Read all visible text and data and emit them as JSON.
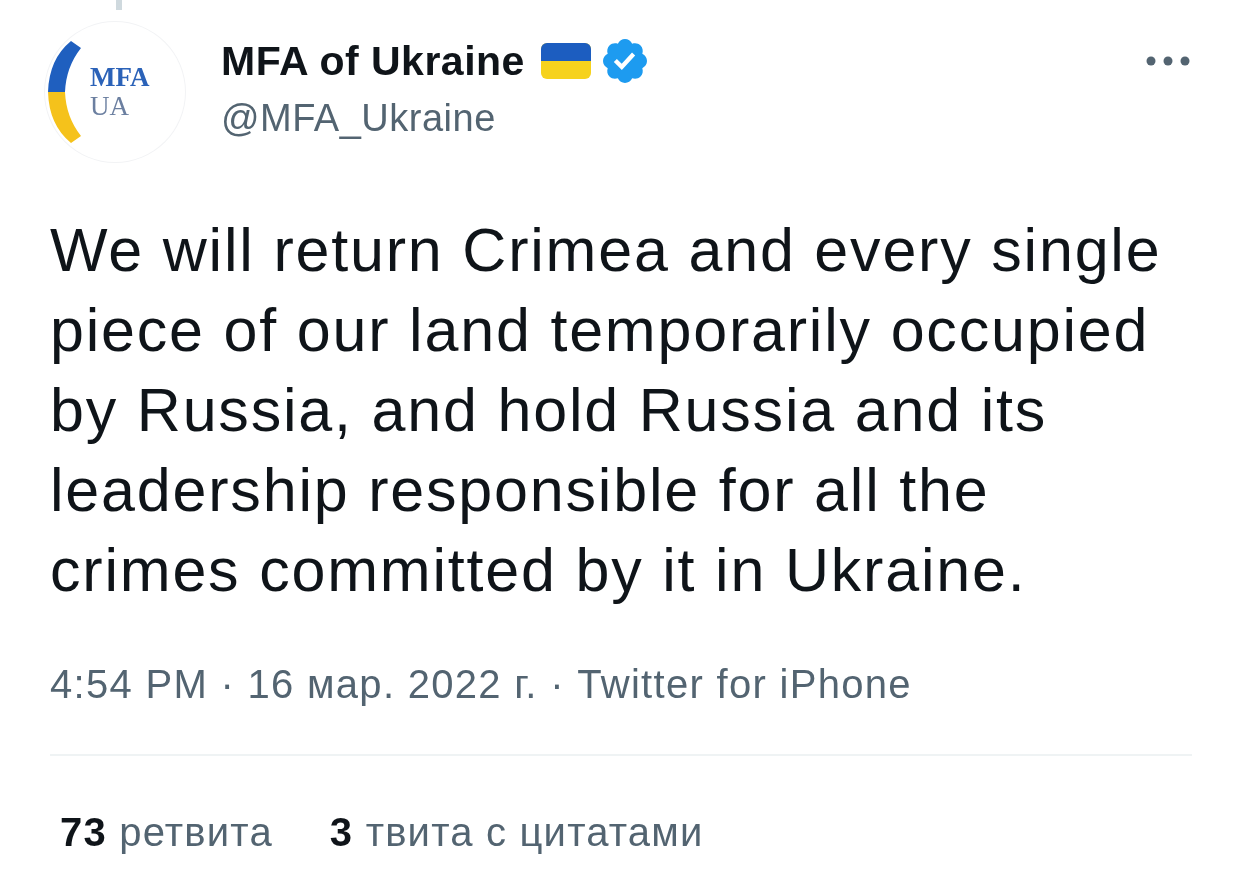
{
  "author": {
    "avatar_logo": [
      "MFA",
      "UA"
    ],
    "name": "MFA of Ukraine",
    "verified": true,
    "handle": "@MFA_Ukraine"
  },
  "tweet": {
    "text": "We will return Crimea and every single piece of our land temporarily occupied by Russia, and hold Russia and its leadership responsible for all the crimes committed by it in Ukraine.",
    "meta": "4:54 PM · 16 мар. 2022 г. · Twitter for iPhone"
  },
  "stats": [
    {
      "count": "73",
      "label": "ретвита"
    },
    {
      "count": "3",
      "label": "твита с цитатами"
    }
  ]
}
